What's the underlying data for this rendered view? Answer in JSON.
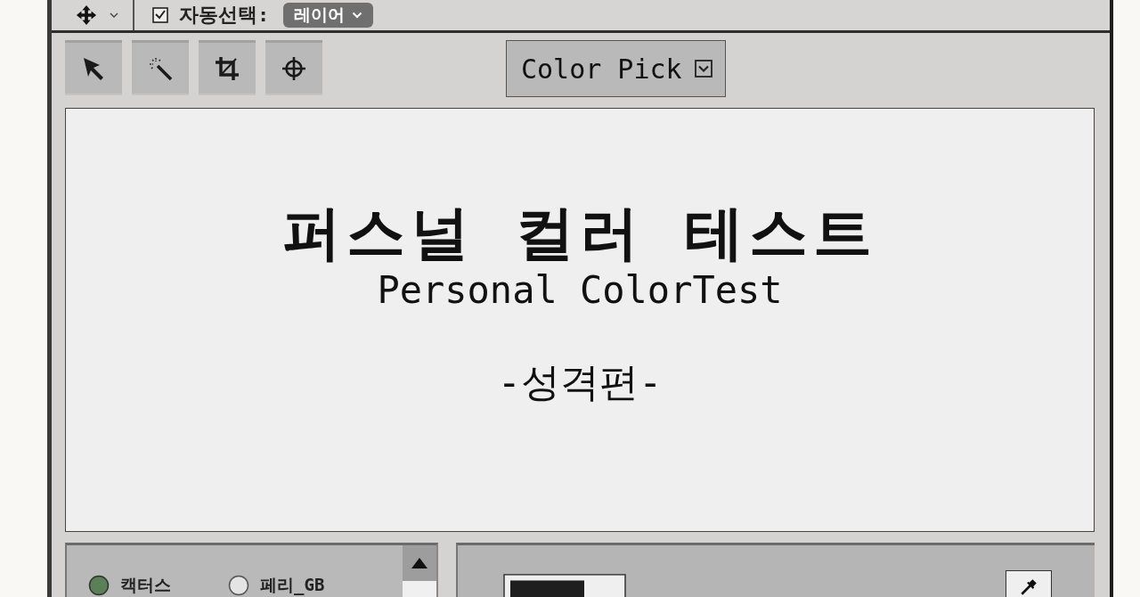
{
  "options_bar": {
    "auto_select": {
      "label": "자동선택:",
      "checked": true
    },
    "target_dropdown": {
      "value": "레이어"
    }
  },
  "mode_dropdown": {
    "label": "Color Pick"
  },
  "canvas": {
    "title": "퍼스널 컬러 테스트",
    "subtitle": "Personal ColorTest",
    "edition": "-성격편-"
  },
  "swatch_list": {
    "items": [
      {
        "label": "캑터스",
        "selected": true
      },
      {
        "label": "페리_GB",
        "selected": false
      }
    ]
  }
}
